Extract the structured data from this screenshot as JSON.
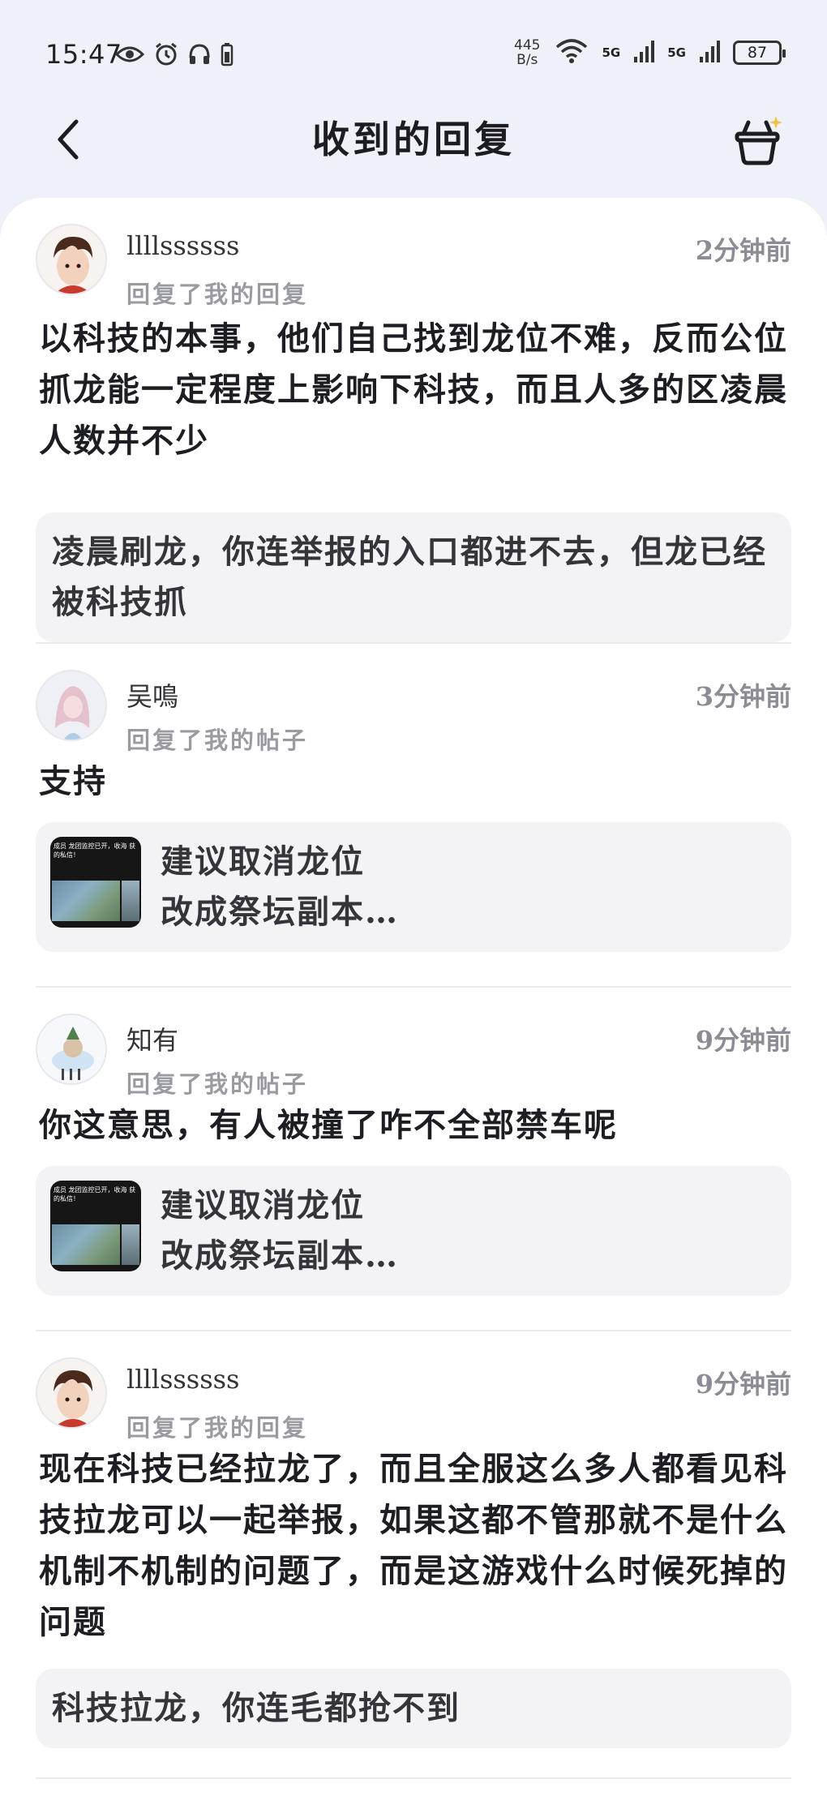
{
  "status_bar": {
    "time": "15:47",
    "net_speed_value": "445",
    "net_speed_unit": "B/s",
    "net1": "5G",
    "net2": "5G",
    "battery": "87",
    "icons": [
      "eye-icon",
      "alarm-icon",
      "headphones-icon",
      "battery-small-icon",
      "wifi-icon",
      "signal-icon"
    ]
  },
  "header": {
    "title": "收到的回复",
    "back_icon": "chevron-left-icon",
    "cart_icon": "shopping-basket-icon"
  },
  "replies": [
    {
      "username": "llllssssss",
      "time": "2分钟前",
      "action": "回复了我的回复",
      "content": "以科技的本事，他们自己找到龙位不难，反而公位抓龙能一定程度上影响下科技，而且人多的区凌晨人数并不少",
      "quote": "凌晨刷龙，你连举报的入口都进不去，但龙已经被科技抓"
    },
    {
      "username": "吴鳴",
      "time": "3分钟前",
      "action": "回复了我的帖子",
      "content": "支持",
      "quote_line1": "建议取消龙位",
      "quote_line2": "改成祭坛副本…",
      "thumb_text": "成员 龙团监控已开，收海 获的私信！"
    },
    {
      "username": "知有",
      "time": "9分钟前",
      "action": "回复了我的帖子",
      "content": "你这意思，有人被撞了咋不全部禁车呢",
      "quote_line1": "建议取消龙位",
      "quote_line2": "改成祭坛副本…",
      "thumb_text": "成员 龙团监控已开，收海 获的私信！"
    },
    {
      "username": "llllssssss",
      "time": "9分钟前",
      "action": "回复了我的回复",
      "content": "现在科技已经拉龙了，而且全服这么多人都看见科技拉龙可以一起举报，如果这都不管那就不是什么机制不机制的问题了，而是这游戏什么时候死掉的问题",
      "quote": "科技拉龙，你连毛都抢不到"
    }
  ]
}
